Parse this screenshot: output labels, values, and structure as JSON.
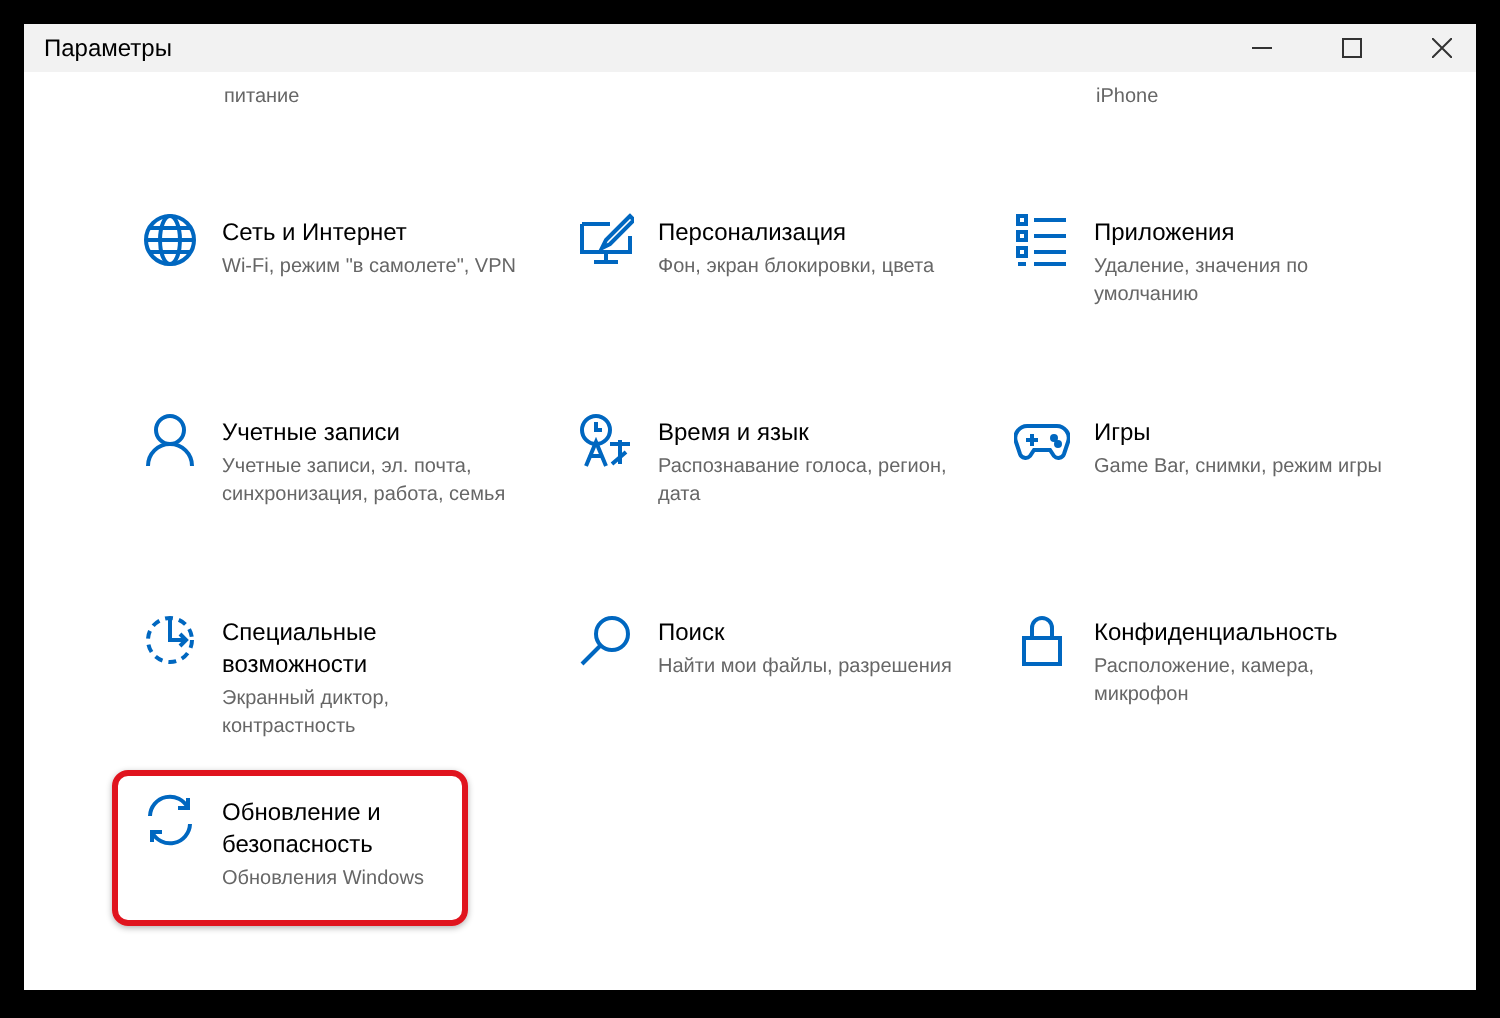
{
  "window": {
    "title": "Параметры"
  },
  "top_row": {
    "left": "питание",
    "right": "iPhone"
  },
  "items": [
    {
      "kind": "network",
      "title": "Сеть и Интернет",
      "desc": "Wi-Fi, режим \"в самолете\", VPN",
      "highlighted": false
    },
    {
      "kind": "personalization",
      "title": "Персонализация",
      "desc": "Фон, экран блокировки, цвета",
      "highlighted": false
    },
    {
      "kind": "apps",
      "title": "Приложения",
      "desc": "Удаление, значения по умолчанию",
      "highlighted": false
    },
    {
      "kind": "accounts",
      "title": "Учетные записи",
      "desc": "Учетные записи, эл. почта, синхронизация, работа, семья",
      "highlighted": false
    },
    {
      "kind": "time",
      "title": "Время и язык",
      "desc": "Распознавание голоса, регион, дата",
      "highlighted": false
    },
    {
      "kind": "gaming",
      "title": "Игры",
      "desc": "Game Bar, снимки, режим игры",
      "highlighted": false
    },
    {
      "kind": "accessibility",
      "title": "Специальные возможности",
      "desc": "Экранный диктор, контрастность",
      "highlighted": false
    },
    {
      "kind": "search",
      "title": "Поиск",
      "desc": "Найти мои файлы, разрешения",
      "highlighted": false
    },
    {
      "kind": "privacy",
      "title": "Конфиденциальность",
      "desc": "Расположение, камера, микрофон",
      "highlighted": false
    },
    {
      "kind": "update",
      "title": "Обновление и безопасность",
      "desc": "Обновления Windows",
      "highlighted": true
    }
  ]
}
